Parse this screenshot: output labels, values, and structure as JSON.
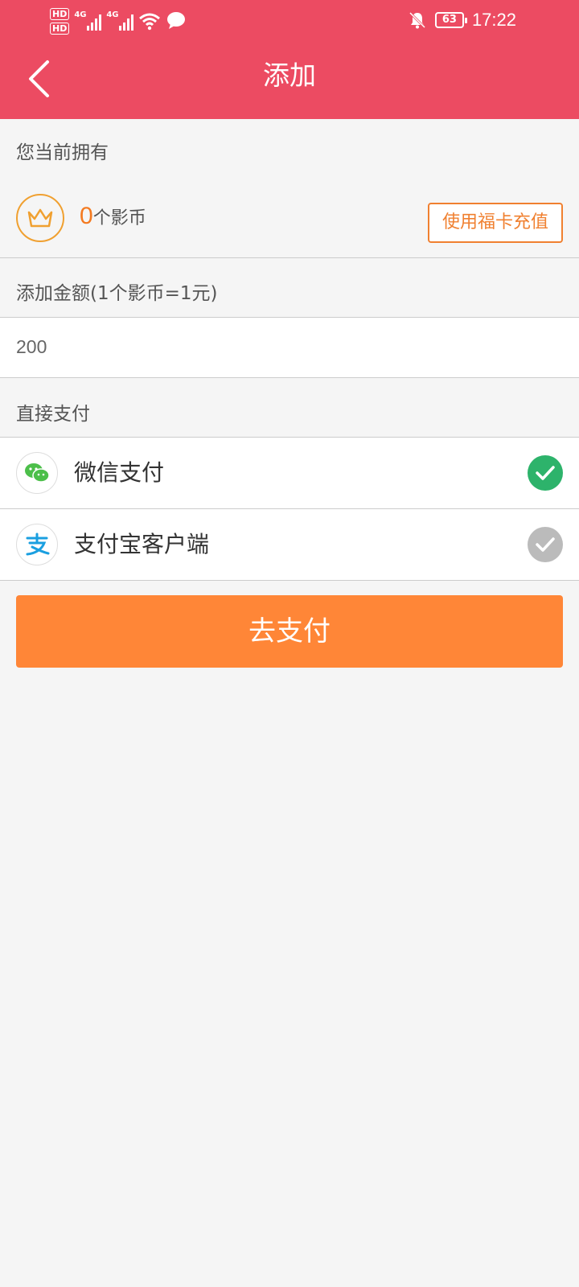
{
  "status_bar": {
    "hd1": "HD",
    "hd2": "HD",
    "net1": "4G",
    "net2": "4G",
    "battery": "63",
    "time": "17:22"
  },
  "header": {
    "title": "添加"
  },
  "balance": {
    "label": "您当前拥有",
    "amount": "0",
    "unit": "个影币",
    "recharge_button": "使用福卡充值"
  },
  "amount": {
    "label": "添加金额(1个影币=1元)",
    "value": "200"
  },
  "payment": {
    "label": "直接支付",
    "methods": [
      {
        "name": "微信支付",
        "icon": "wechat-icon",
        "selected": true
      },
      {
        "name": "支付宝客户端",
        "icon": "alipay-icon",
        "selected": false
      }
    ]
  },
  "pay_button": "去支付",
  "colors": {
    "header": "#ec4b62",
    "accent": "#f47a20",
    "pay_button": "#ff8637",
    "check_selected": "#2db36b",
    "check_unselected": "#bbbbbb"
  }
}
